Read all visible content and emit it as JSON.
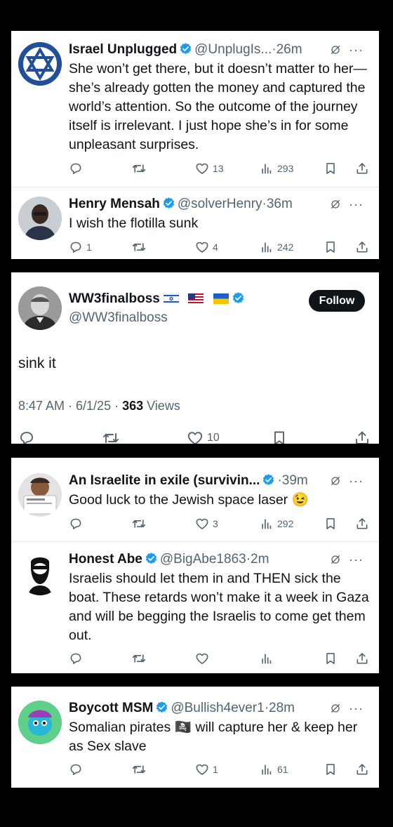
{
  "colors": {
    "verified": "#1d9bf0",
    "text": "#0f1419",
    "secondary": "#536471",
    "divider": "#e6e9ea"
  },
  "panel1": {
    "tweets": [
      {
        "name": "Israel Unplugged",
        "handle": "@UnplugIs...",
        "time": "26m",
        "text": "She won’t get there, but it doesn’t matter to her—she’s already gotten the money and captured the world’s attention. So the outcome of the journey itself is irrelevant. I just hope she’s in for some unpleasant surprises.",
        "replies": "",
        "retweets": "",
        "likes": "13",
        "views": "293"
      },
      {
        "name": "Henry Mensah",
        "handle": "@solverHenry",
        "time": "36m",
        "text": "I wish the flotilla sunk",
        "replies": "1",
        "retweets": "",
        "likes": "4",
        "views": "242"
      }
    ]
  },
  "panel2": {
    "name": "WW3finalboss",
    "flags": [
      "israel-flag",
      "usa-flag",
      "ukraine-flag"
    ],
    "handle": "@WW3finalboss",
    "follow_label": "Follow",
    "text": "sink it",
    "timestamp": "8:47 AM · 6/1/25 · ",
    "views_count": "363",
    "views_label": " Views",
    "likes": "10"
  },
  "panel3": {
    "tweets": [
      {
        "name": "An Israelite in exile (survivin...",
        "handle": "",
        "time": "39m",
        "text": "Good luck to the Jewish space laser 😉",
        "replies": "",
        "retweets": "",
        "likes": "3",
        "views": "292"
      },
      {
        "name": "Honest Abe",
        "handle": "@BigAbe1863",
        "time": "2m",
        "text": "Israelis should let them in and THEN sick the boat. These retards won’t make it a week in Gaza and will be begging the Israelis to come get them out.",
        "replies": "",
        "retweets": "",
        "likes": "",
        "views": ""
      }
    ]
  },
  "panel4": {
    "tweets": [
      {
        "name": "Boycott MSM",
        "handle": "@Bullish4ever1",
        "time": "28m",
        "text": "Somalian pirates 🏴‍☠️ will capture her & keep her as Sex slave",
        "replies": "",
        "retweets": "",
        "likes": "1",
        "views": "61"
      }
    ]
  }
}
